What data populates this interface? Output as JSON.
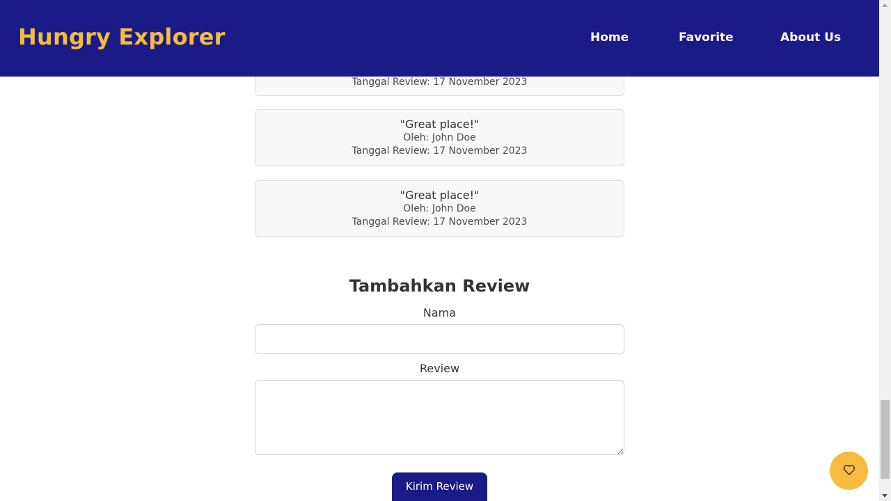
{
  "app": {
    "brand": "Hungry Explorer"
  },
  "nav": {
    "items": [
      {
        "label": "Home"
      },
      {
        "label": "Favorite"
      },
      {
        "label": "About Us"
      }
    ]
  },
  "reviews": [
    {
      "date": "Tanggal Review: 17 November 2023"
    },
    {
      "quote": "\"Great place!\"",
      "by": "Oleh: John Doe",
      "date": "Tanggal Review: 17 November 2023"
    },
    {
      "quote": "\"Great place!\"",
      "by": "Oleh: John Doe",
      "date": "Tanggal Review: 17 November 2023"
    }
  ],
  "form": {
    "title": "Tambahkan Review",
    "name_label": "Nama",
    "name_value": "",
    "review_label": "Review",
    "review_value": "",
    "submit_label": "Kirim Review"
  },
  "floating_button": {
    "icon": "heart-icon",
    "color": "#f7bb3d"
  },
  "colors": {
    "header_bg": "#1a1b87",
    "brand": "#f7bb3d",
    "button_bg": "#1a1b87"
  }
}
